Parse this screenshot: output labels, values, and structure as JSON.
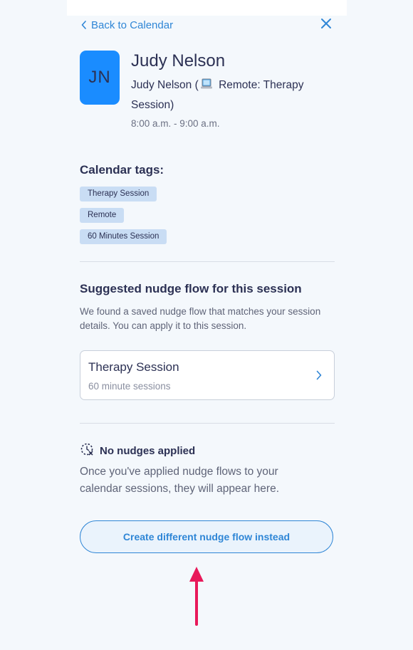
{
  "header": {
    "back_label": "Back to Calendar",
    "back_icon": "chevron-left-icon",
    "close_icon": "close-icon"
  },
  "client": {
    "initials": "JN",
    "name": "Judy Nelson",
    "event_prefix": "Judy Nelson (",
    "event_suffix": " Remote: Therapy Session)",
    "event_icon": "laptop-icon",
    "time": "8:00 a.m. - 9:00 a.m."
  },
  "tags": {
    "title": "Calendar tags:",
    "items": [
      "Therapy Session",
      "Remote",
      "60 Minutes Session"
    ]
  },
  "suggestion": {
    "title": "Suggested nudge flow for this session",
    "description": "We found a saved nudge flow that matches your session details. You can apply it to this session.",
    "flow": {
      "name": "Therapy Session",
      "subtitle": "60 minute sessions",
      "icon": "chevron-right-icon"
    }
  },
  "nudges": {
    "icon": "no-nudges-clock-icon",
    "title": "No nudges applied",
    "description": "Once you've applied nudge flows to your calendar sessions, they will appear here."
  },
  "create_button": {
    "label": "Create different nudge flow instead"
  },
  "colors": {
    "accent": "#2f86d6",
    "avatar_bg": "#1a8cff",
    "tag_bg": "#c9ddf4",
    "annotation_arrow": "#e8195a",
    "page_bg": "#f4f8fc"
  }
}
